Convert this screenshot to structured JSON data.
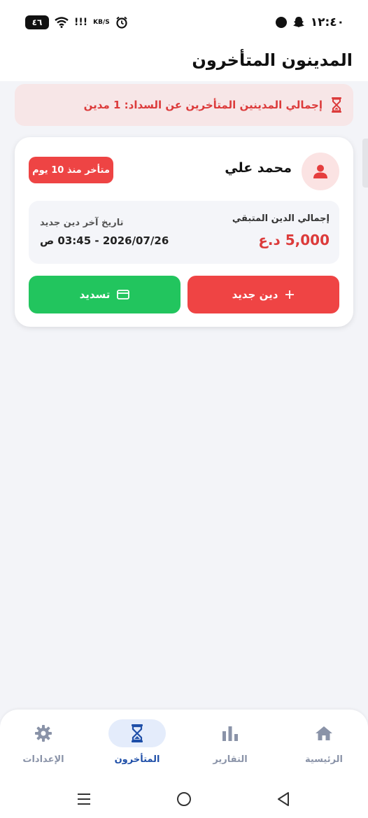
{
  "status_bar": {
    "time": "١٢:٤٠",
    "battery": "٤٦",
    "signal_text": "!!!",
    "speed_text": "KB/S"
  },
  "page": {
    "title": "المدينون المتأخرون"
  },
  "alert": {
    "text": "إجمالي المدينين المتأخرين عن السداد: 1 مدين",
    "color": "#dc3b3b",
    "background": "#f7e6e7"
  },
  "debtor": {
    "name": "محمد علي",
    "overdue_badge": "متأخر منذ 10 يوم",
    "remaining_label": "إجمالي الدين المتبقي",
    "remaining_amount": "5,000 د.ع",
    "last_debt_label": "تاريخ آخر دين جديد",
    "last_debt_date": "2026/07/26 - 03:45 ص",
    "new_debt_button": "دين جديد",
    "pay_button": "تسديد"
  },
  "colors": {
    "danger": "#ef4444",
    "success": "#22c55e",
    "nav_active": "#1f4fa8",
    "nav_inactive": "#8a93a8"
  },
  "bottom_nav": {
    "items": [
      {
        "label": "الرئيسية",
        "icon": "home-icon",
        "active": false
      },
      {
        "label": "التقارير",
        "icon": "bar-chart-icon",
        "active": false
      },
      {
        "label": "المتأخرون",
        "icon": "hourglass-icon",
        "active": true
      },
      {
        "label": "الإعدادات",
        "icon": "gear-icon",
        "active": false
      }
    ]
  }
}
